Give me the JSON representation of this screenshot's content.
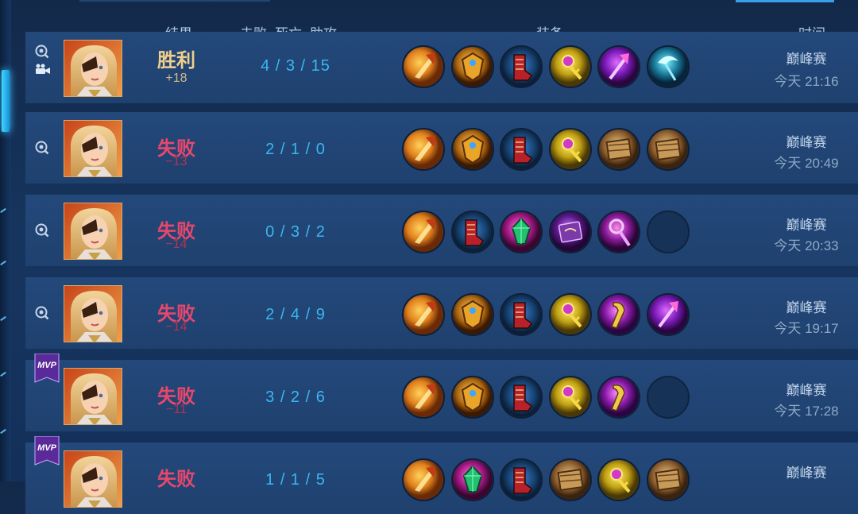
{
  "header": {
    "result": "结果",
    "kills": "击败",
    "deaths": "死亡",
    "assists": "助攻",
    "equipment": "装备",
    "time": "时间"
  },
  "colors": {
    "win": "#f0cf8c",
    "loss": "#e8476c",
    "kda": "#3ab7ef"
  },
  "matches": [
    {
      "result": "胜利",
      "result_type": "win",
      "delta": "+18",
      "kda": "4 / 3 / 15",
      "mode": "巅峰赛",
      "time": "今天 21:16",
      "mvp": false,
      "replay_icon": "replay-icon",
      "video_icon": "video-camera-icon",
      "items": [
        "golden-axe",
        "golden-shield",
        "red-boots",
        "golden-scepter",
        "purple-trident",
        "teal-scythe"
      ]
    },
    {
      "result": "失败",
      "result_type": "loss",
      "delta": "−13",
      "kda": "2 / 1 / 0",
      "mode": "巅峰赛",
      "time": "今天 20:49",
      "mvp": false,
      "replay_icon": "replay-icon",
      "items": [
        "golden-axe",
        "golden-shield",
        "red-boots",
        "golden-scepter",
        "wooden-crate",
        "wooden-crate"
      ]
    },
    {
      "result": "失败",
      "result_type": "loss",
      "delta": "−14",
      "kda": "0 / 3 / 2",
      "mode": "巅峰赛",
      "time": "今天 20:33",
      "mvp": false,
      "replay_icon": "replay-icon",
      "items": [
        "golden-axe",
        "red-boots",
        "green-gem",
        "purple-book",
        "purple-staff",
        "empty"
      ]
    },
    {
      "result": "失败",
      "result_type": "loss",
      "delta": "−14",
      "kda": "2 / 4 / 9",
      "mode": "巅峰赛",
      "time": "今天 19:17",
      "mvp": false,
      "replay_icon": "replay-icon",
      "items": [
        "golden-axe",
        "golden-shield",
        "red-boots",
        "golden-scepter",
        "golden-staff",
        "purple-trident"
      ]
    },
    {
      "result": "失败",
      "result_type": "loss",
      "delta": "−11",
      "kda": "3 / 2 / 6",
      "mode": "巅峰赛",
      "time": "今天 17:28",
      "mvp": true,
      "mvp_label": "MVP",
      "items": [
        "golden-axe",
        "golden-shield",
        "red-boots",
        "golden-scepter",
        "golden-staff",
        "empty"
      ]
    },
    {
      "result": "失败",
      "result_type": "loss",
      "delta": "",
      "kda": "1 / 1 / 5",
      "mode": "巅峰赛",
      "time": "",
      "mvp": true,
      "mvp_label": "MVP",
      "items": [
        "golden-axe",
        "green-gem",
        "red-boots",
        "wooden-crate",
        "golden-scepter",
        "wooden-crate"
      ]
    }
  ]
}
